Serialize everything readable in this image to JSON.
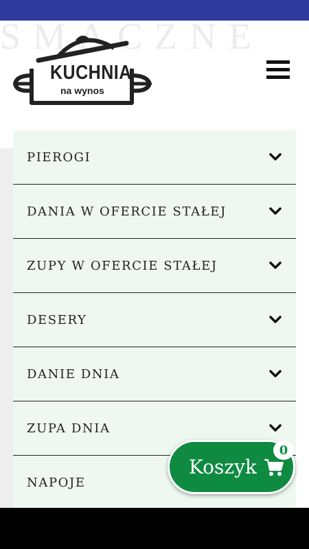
{
  "watermark": "SMACZNE",
  "logo": {
    "main_text": "KUCHNIA",
    "sub_text": "na wynos"
  },
  "menu": {
    "items": [
      {
        "label": "PIEROGI"
      },
      {
        "label": "DANIA W OFERCIE STAŁEJ"
      },
      {
        "label": "ZUPY W OFERCIE STAŁEJ"
      },
      {
        "label": "DESERY"
      },
      {
        "label": "DANIE DNIA"
      },
      {
        "label": "ZUPA DNIA"
      },
      {
        "label": "NAPOJE"
      }
    ]
  },
  "cart": {
    "label": "Koszyk",
    "count": "0"
  },
  "icons": {
    "menu": "hamburger-icon",
    "chevron": "chevron-down-icon",
    "cart": "shopping-cart-icon"
  },
  "colors": {
    "status_bar": "#2f3b9e",
    "menu_bg": "#eef8f1",
    "cart_green": "#0f8a41"
  }
}
